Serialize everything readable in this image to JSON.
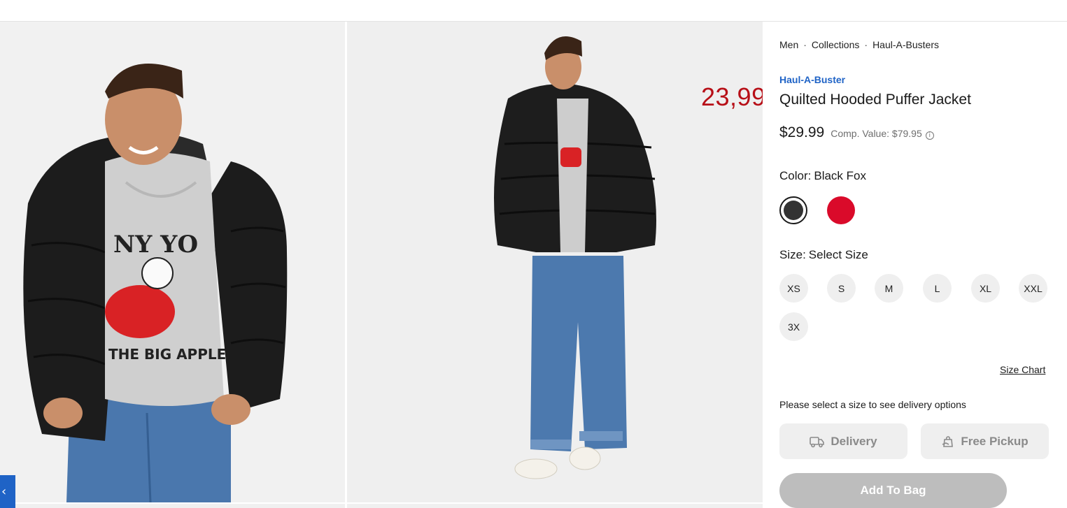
{
  "breadcrumb": {
    "items": [
      "Men",
      "Collections",
      "Haul-A-Busters"
    ],
    "separator": "·"
  },
  "overlay_price": "23,99",
  "product": {
    "brand": "Haul-A-Buster",
    "title": "Quilted Hooded Puffer Jacket",
    "price": "$29.99",
    "comp_value": "Comp. Value: $79.95",
    "info_glyph": "i"
  },
  "color": {
    "label": "Color:",
    "selected": "Black Fox",
    "swatches": [
      {
        "name": "Black Fox",
        "hex": "#333333",
        "selected": true
      },
      {
        "name": "Red",
        "hex": "#da0a2a",
        "selected": false
      }
    ]
  },
  "size": {
    "label": "Size:",
    "selected": "Select Size",
    "options": [
      "XS",
      "S",
      "M",
      "L",
      "XL",
      "XXL",
      "3X"
    ],
    "chart_link": "Size Chart"
  },
  "fulfillment": {
    "note": "Please select a size to see delivery options",
    "delivery_label": "Delivery",
    "pickup_label": "Free Pickup"
  },
  "cta": {
    "add_to_bag": "Add To Bag"
  },
  "gallery": {
    "prev_glyph": "‹"
  },
  "colors": {
    "accent": "#1f63c6",
    "sale": "#b70f17",
    "disabled": "#bdbdbd"
  }
}
